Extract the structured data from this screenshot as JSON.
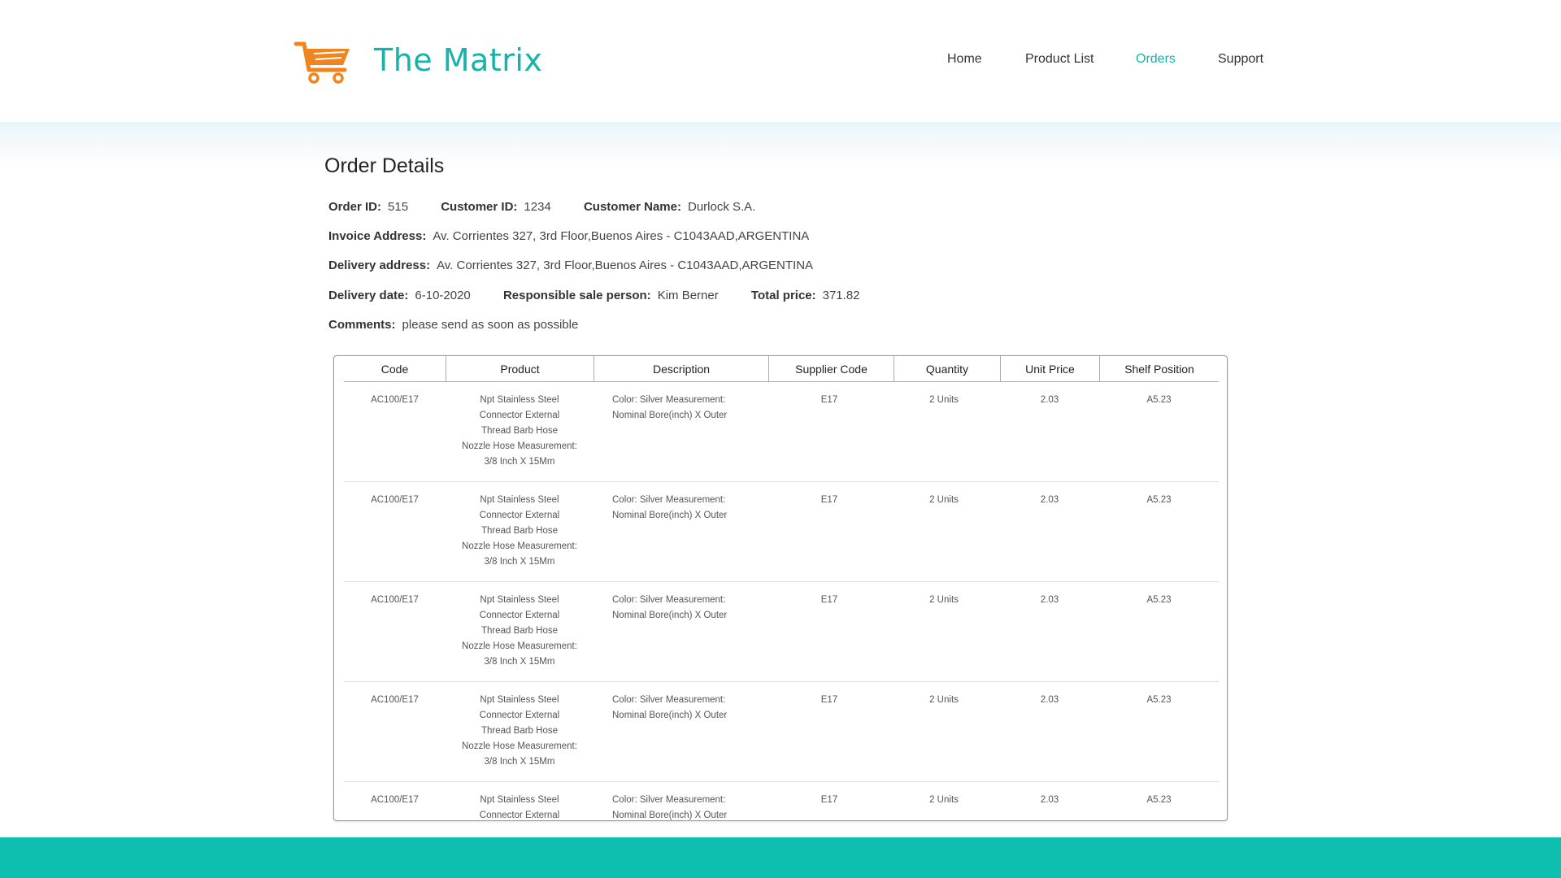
{
  "header": {
    "brand": "The Matrix",
    "logo_icon": "shopping-cart-icon",
    "accent_color": "#15b3a8",
    "logo_color": "#f0841f",
    "nav": [
      {
        "label": "Home",
        "active": false
      },
      {
        "label": "Product List",
        "active": false
      },
      {
        "label": "Orders",
        "active": true
      },
      {
        "label": "Support",
        "active": false
      }
    ]
  },
  "order": {
    "title": "Order Details",
    "order_id_label": "Order ID:",
    "order_id": "515",
    "customer_id_label": "Customer ID:",
    "customer_id": "1234",
    "customer_name_label": "Customer Name:",
    "customer_name": "Durlock S.A.",
    "invoice_address_label": "Invoice Address:",
    "invoice_address": "Av. Corrientes 327, 3rd Floor,Buenos Aires - C1043AAD,ARGENTINA",
    "delivery_address_label": "Delivery address:",
    "delivery_address": "Av. Corrientes 327, 3rd Floor,Buenos Aires - C1043AAD,ARGENTINA",
    "delivery_date_label": "Delivery date:",
    "delivery_date": "6-10-2020",
    "sale_person_label": "Responsible sale person:",
    "sale_person": "Kim Berner",
    "total_price_label": "Total price:",
    "total_price": "371.82",
    "comments_label": "Comments:",
    "comments": "please send as soon as possible"
  },
  "table": {
    "columns": [
      "Code",
      "Product",
      "Description",
      "Supplier Code",
      "Quantity",
      "Unit Price",
      "Shelf Position"
    ],
    "rows": [
      {
        "code": "AC100/E17",
        "product": [
          "Npt Stainless Steel",
          "Connector External",
          "Thread Barb Hose",
          "Nozzle Hose Measurement:",
          "3/8 Inch X 15Mm"
        ],
        "description": [
          "Color: Silver Measurement:",
          "Nominal Bore(inch) X Outer"
        ],
        "supplier_code": "E17",
        "quantity": "2 Units",
        "unit_price": "2.03",
        "shelf": "A5.23"
      },
      {
        "code": "AC100/E17",
        "product": [
          "Npt Stainless Steel",
          "Connector External",
          "Thread Barb Hose",
          "Nozzle Hose Measurement:",
          "3/8 Inch X 15Mm"
        ],
        "description": [
          "Color: Silver Measurement:",
          "Nominal Bore(inch) X Outer"
        ],
        "supplier_code": "E17",
        "quantity": "2 Units",
        "unit_price": "2.03",
        "shelf": "A5.23"
      },
      {
        "code": "AC100/E17",
        "product": [
          "Npt Stainless Steel",
          "Connector External",
          "Thread Barb Hose",
          "Nozzle Hose Measurement:",
          "3/8 Inch X 15Mm"
        ],
        "description": [
          "Color: Silver Measurement:",
          "Nominal Bore(inch) X Outer"
        ],
        "supplier_code": "E17",
        "quantity": "2 Units",
        "unit_price": "2.03",
        "shelf": "A5.23"
      },
      {
        "code": "AC100/E17",
        "product": [
          "Npt Stainless Steel",
          "Connector External",
          "Thread Barb Hose",
          "Nozzle Hose Measurement:",
          "3/8 Inch X 15Mm"
        ],
        "description": [
          "Color: Silver Measurement:",
          "Nominal Bore(inch) X Outer"
        ],
        "supplier_code": "E17",
        "quantity": "2 Units",
        "unit_price": "2.03",
        "shelf": "A5.23"
      },
      {
        "code": "AC100/E17",
        "product": [
          "Npt Stainless Steel",
          "Connector External"
        ],
        "description": [
          "Color: Silver Measurement:",
          "Nominal Bore(inch) X Outer"
        ],
        "supplier_code": "E17",
        "quantity": "2 Units",
        "unit_price": "2.03",
        "shelf": "A5.23"
      }
    ]
  },
  "footer": {
    "color": "#0ebfb0"
  }
}
